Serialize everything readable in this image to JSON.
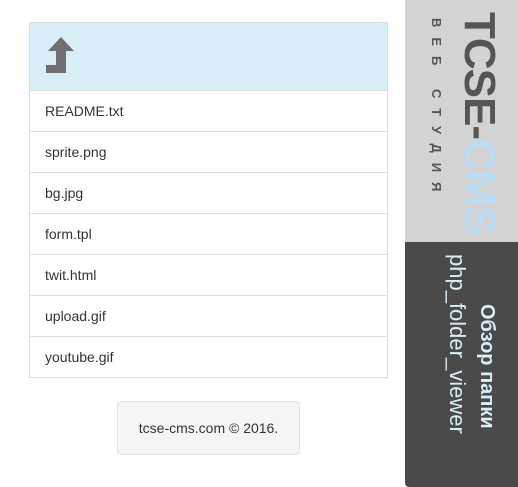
{
  "file_list": {
    "up_icon": "arrow-up-turn-icon",
    "items": [
      "README.txt",
      "sprite.png",
      "bg.jpg",
      "form.tpl",
      "twit.html",
      "upload.gif",
      "youtube.gif"
    ]
  },
  "footer": {
    "text": "tcse-cms.com © 2016."
  },
  "brand": {
    "title_main": "TCSE-",
    "title_accent": "CMS",
    "subtitle": "ВЕБ СТУДИЯ",
    "colors": {
      "panel": "#d3d3d3",
      "text": "#555555",
      "accent": "#bcdcf2"
    }
  },
  "info": {
    "title": "Обзор папки",
    "folder": "php_folder_viewer",
    "colors": {
      "panel": "#4a4a4a",
      "text": "#d9edf7"
    }
  }
}
